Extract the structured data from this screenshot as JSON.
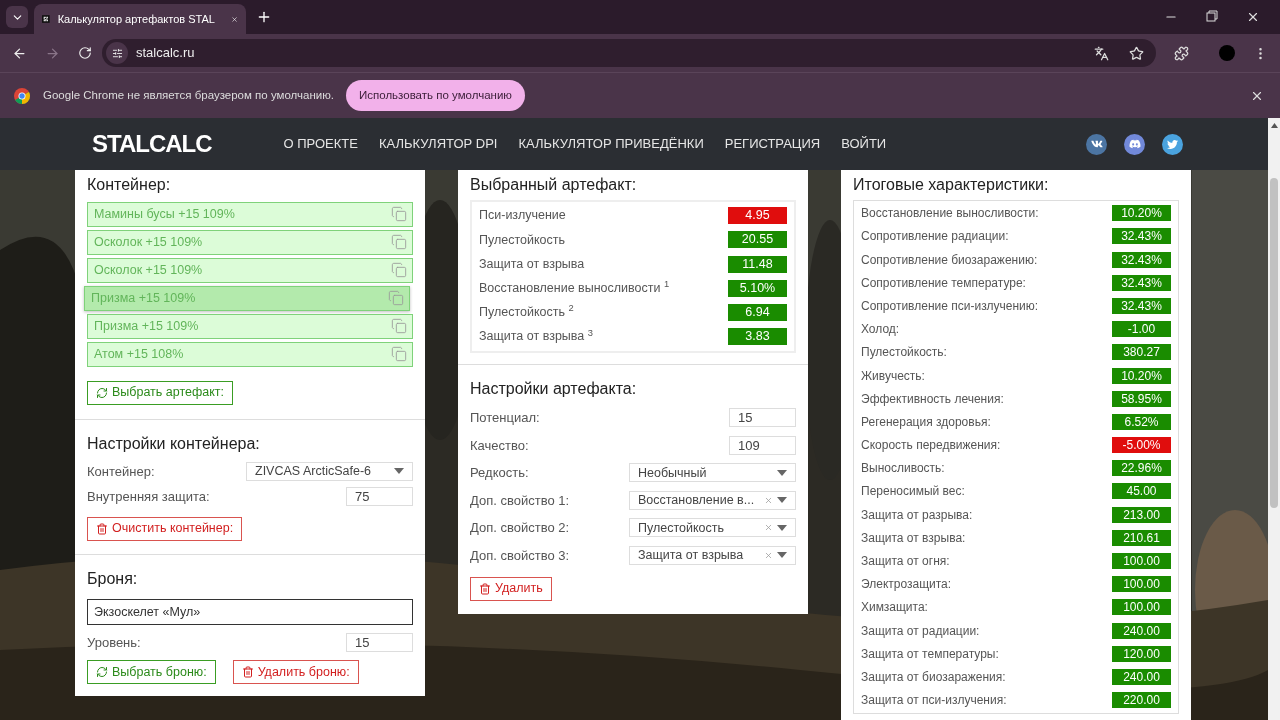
{
  "browser": {
    "tab_title": "Калькулятор артефактов STAL",
    "url": "stalcalc.ru",
    "infobar_message": "Google Chrome не является браузером по умолчанию.",
    "infobar_button": "Использовать по умолчанию"
  },
  "site": {
    "logo": "STALCALC",
    "nav": [
      "О ПРОЕКТЕ",
      "КАЛЬКУЛЯТОР DPI",
      "КАЛЬКУЛЯТОР ПРИВЕДЁНКИ",
      "РЕГИСТРАЦИЯ",
      "ВОЙТИ"
    ]
  },
  "container_panel": {
    "title": "Контейнер:",
    "artifacts": [
      {
        "label": "Мамины бусы +15 109%",
        "selected": false
      },
      {
        "label": "Осколок +15 109%",
        "selected": false
      },
      {
        "label": "Осколок +15 109%",
        "selected": false
      },
      {
        "label": "Призма +15 109%",
        "selected": true
      },
      {
        "label": "Призма +15 109%",
        "selected": false
      },
      {
        "label": "Атом +15 108%",
        "selected": false
      }
    ],
    "choose_button": "Выбрать артефакт:",
    "settings_title": "Настройки контейнера:",
    "container_label": "Контейнер:",
    "container_value": "ZIVCAS ArcticSafe-6",
    "protection_label": "Внутренняя защита:",
    "protection_value": "75",
    "clear_button": "Очистить контейнер:",
    "armor_title": "Броня:",
    "armor_value": "Экзоскелет «Мул»",
    "level_label": "Уровень:",
    "level_value": "15",
    "choose_armor_button": "Выбрать броню:",
    "delete_armor_button": "Удалить броню:"
  },
  "artifact_panel": {
    "title": "Выбранный артефакт:",
    "stats": [
      {
        "name": "Пси-излучение",
        "value": "4.95",
        "color": "#e00d0d"
      },
      {
        "name": "Пулестойкость",
        "value": "20.55",
        "color": "#1a8c00"
      },
      {
        "name": "Защита от взрыва",
        "value": "11.48",
        "color": "#1a8c00"
      },
      {
        "name": "Восстановление выносливости $^{1}$",
        "value": "5.10%",
        "color": "#1a8c00"
      },
      {
        "name": "Пулестойкость $^{2}$",
        "value": "6.94",
        "color": "#1a8c00"
      },
      {
        "name": "Защита от взрыва $^{3}$",
        "value": "3.83",
        "color": "#1a8c00"
      }
    ],
    "settings_title": "Настройки артефакта:",
    "fields": [
      {
        "label": "Потенциал:",
        "value": "15",
        "kind": "input"
      },
      {
        "label": "Качество:",
        "value": "109",
        "kind": "input"
      },
      {
        "label": "Редкость:",
        "value": "Необычный",
        "kind": "select"
      },
      {
        "label": "Доп. свойство 1:",
        "value": "Восстановление в...",
        "kind": "clearable"
      },
      {
        "label": "Доп. свойство 2:",
        "value": "Пулестойкость",
        "kind": "clearable"
      },
      {
        "label": "Доп. свойство 3:",
        "value": "Защита от взрыва",
        "kind": "clearable"
      }
    ],
    "delete_button": "Удалить"
  },
  "totals_panel": {
    "title": "Итоговые характеристики:",
    "stats": [
      {
        "name": "Восстановление выносливости:",
        "value": "10.20%",
        "color": "#1a8c00"
      },
      {
        "name": "Сопротивление радиации:",
        "value": "32.43%",
        "color": "#1a8c00"
      },
      {
        "name": "Сопротивление биозаражению:",
        "value": "32.43%",
        "color": "#1a8c00"
      },
      {
        "name": "Сопротивление температуре:",
        "value": "32.43%",
        "color": "#1a8c00"
      },
      {
        "name": "Сопротивление пси-излучению:",
        "value": "32.43%",
        "color": "#1a8c00"
      },
      {
        "name": "Холод:",
        "value": "-1.00",
        "color": "#1a8c00"
      },
      {
        "name": "Пулестойкость:",
        "value": "380.27",
        "color": "#1a8c00"
      },
      {
        "name": "Живучесть:",
        "value": "10.20%",
        "color": "#1a8c00"
      },
      {
        "name": "Эффективность лечения:",
        "value": "58.95%",
        "color": "#1a8c00"
      },
      {
        "name": "Регенерация здоровья:",
        "value": "6.52%",
        "color": "#1a8c00"
      },
      {
        "name": "Скорость передвижения:",
        "value": "-5.00%",
        "color": "#e00d0d"
      },
      {
        "name": "Выносливость:",
        "value": "22.96%",
        "color": "#1a8c00"
      },
      {
        "name": "Переносимый вес:",
        "value": "45.00",
        "color": "#1a8c00"
      },
      {
        "name": "Защита от разрыва:",
        "value": "213.00",
        "color": "#1a8c00"
      },
      {
        "name": "Защита от взрыва:",
        "value": "210.61",
        "color": "#1a8c00"
      },
      {
        "name": "Защита от огня:",
        "value": "100.00",
        "color": "#1a8c00"
      },
      {
        "name": "Электрозащита:",
        "value": "100.00",
        "color": "#1a8c00"
      },
      {
        "name": "Химзащита:",
        "value": "100.00",
        "color": "#1a8c00"
      },
      {
        "name": "Защита от радиации:",
        "value": "240.00",
        "color": "#1a8c00"
      },
      {
        "name": "Защита от температуры:",
        "value": "120.00",
        "color": "#1a8c00"
      },
      {
        "name": "Защита от биозаражения:",
        "value": "240.00",
        "color": "#1a8c00"
      },
      {
        "name": "Защита от пси-излучения:",
        "value": "220.00",
        "color": "#1a8c00"
      }
    ]
  }
}
